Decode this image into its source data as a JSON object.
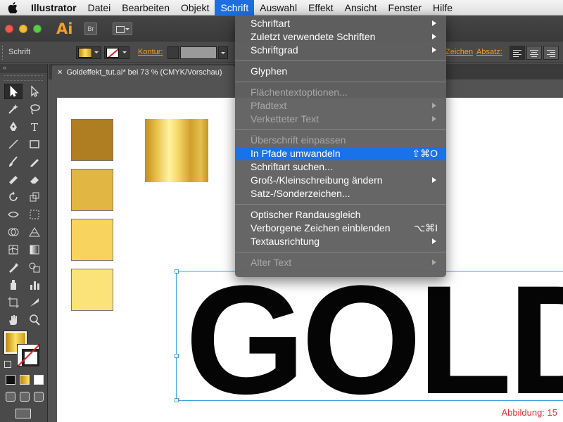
{
  "menubar": {
    "items": [
      {
        "label": "Illustrator"
      },
      {
        "label": "Datei"
      },
      {
        "label": "Bearbeiten"
      },
      {
        "label": "Objekt"
      },
      {
        "label": "Schrift"
      },
      {
        "label": "Auswahl"
      },
      {
        "label": "Effekt"
      },
      {
        "label": "Ansicht"
      },
      {
        "label": "Fenster"
      },
      {
        "label": "Hilfe"
      }
    ],
    "active": "Schrift"
  },
  "appbar": {
    "logo": "Ai",
    "bridge_label": "Br"
  },
  "control_bar": {
    "label": "Schrift",
    "kontur_label": "Kontur:",
    "zeichen_label": "Zeichen",
    "absatz_label": "Absatz:"
  },
  "document": {
    "tab_title": "Goldeffekt_tut.ai* bei 73 % (CMYK/Vorschau)",
    "close": "×"
  },
  "menu": {
    "groups": [
      [
        {
          "label": "Schriftart",
          "submenu": true,
          "disabled": false
        },
        {
          "label": "Zuletzt verwendete Schriften",
          "submenu": true,
          "disabled": false
        },
        {
          "label": "Schriftgrad",
          "submenu": true,
          "disabled": false
        }
      ],
      [
        {
          "label": "Glyphen",
          "submenu": false,
          "disabled": false
        }
      ],
      [
        {
          "label": "Flächentextoptionen...",
          "submenu": false,
          "disabled": true
        },
        {
          "label": "Pfadtext",
          "submenu": true,
          "disabled": true
        },
        {
          "label": "Verketteter Text",
          "submenu": true,
          "disabled": true
        }
      ],
      [
        {
          "label": "Überschrift einpassen",
          "submenu": false,
          "disabled": true
        },
        {
          "label": "In Pfade umwandeln",
          "submenu": false,
          "disabled": false,
          "highlighted": true,
          "shortcut": "⇧⌘O"
        },
        {
          "label": "Schriftart suchen...",
          "submenu": false,
          "disabled": false
        },
        {
          "label": "Groß-/Kleinschreibung ändern",
          "submenu": true,
          "disabled": false
        },
        {
          "label": "Satz-/Sonderzeichen...",
          "submenu": false,
          "disabled": false
        }
      ],
      [
        {
          "label": "Optischer Randausgleich",
          "submenu": false,
          "disabled": false
        },
        {
          "label": "Verborgene Zeichen einblenden",
          "submenu": false,
          "disabled": false,
          "shortcut": "⌥⌘I"
        },
        {
          "label": "Textausrichtung",
          "submenu": true,
          "disabled": false
        }
      ],
      [
        {
          "label": "Alter Text",
          "submenu": true,
          "disabled": true
        }
      ]
    ]
  },
  "artboard": {
    "swatches": [
      "#b07e22",
      "#e2b642",
      "#f8d35e",
      "#fbe37a"
    ],
    "text": "GOLD",
    "caption": "Abbildung: 15"
  },
  "colors": {
    "menu_highlight": "#1a72e8",
    "accent_orange": "#f0a030",
    "selection_blue": "#3fa0e0",
    "caption_red": "#e03030"
  }
}
